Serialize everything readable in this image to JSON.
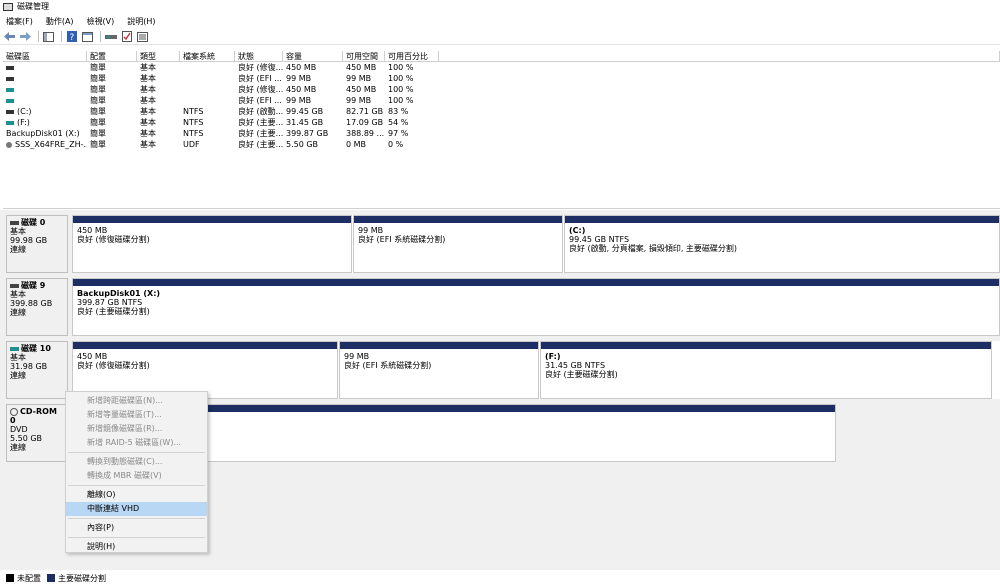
{
  "window": {
    "title": "磁碟管理"
  },
  "menu": [
    "檔案(F)",
    "動作(A)",
    "檢視(V)",
    "說明(H)"
  ],
  "table": {
    "headers": [
      "磁碟區",
      "配置",
      "類型",
      "檔案系統",
      "狀態",
      "容量",
      "可用空間",
      "可用百分比"
    ],
    "rows": [
      {
        "name": "",
        "layout": "簡單",
        "type": "基本",
        "fs": "",
        "status": "良好 (修復...",
        "capacity": "450 MB",
        "free": "450 MB",
        "pct": "100 %",
        "icon": "drive-icon"
      },
      {
        "name": "",
        "layout": "簡單",
        "type": "基本",
        "fs": "",
        "status": "良好 (EFI ...",
        "capacity": "99 MB",
        "free": "99 MB",
        "pct": "100 %",
        "icon": "drive-icon"
      },
      {
        "name": "",
        "layout": "簡單",
        "type": "基本",
        "fs": "",
        "status": "良好 (修復...",
        "capacity": "450 MB",
        "free": "450 MB",
        "pct": "100 %",
        "icon": "drive-icon-teal"
      },
      {
        "name": "",
        "layout": "簡單",
        "type": "基本",
        "fs": "",
        "status": "良好 (EFI ...",
        "capacity": "99 MB",
        "free": "99 MB",
        "pct": "100 %",
        "icon": "drive-icon-teal"
      },
      {
        "name": "(C:)",
        "layout": "簡單",
        "type": "基本",
        "fs": "NTFS",
        "status": "良好 (啟動...",
        "capacity": "99.45 GB",
        "free": "82.71 GB",
        "pct": "83 %",
        "icon": "drive-icon"
      },
      {
        "name": "(F:)",
        "layout": "簡單",
        "type": "基本",
        "fs": "NTFS",
        "status": "良好 (主要...",
        "capacity": "31.45 GB",
        "free": "17.09 GB",
        "pct": "54 %",
        "icon": "drive-icon-teal"
      },
      {
        "name": "BackupDisk01 (X:)",
        "layout": "簡單",
        "type": "基本",
        "fs": "NTFS",
        "status": "良好 (主要...",
        "capacity": "399.87 GB",
        "free": "388.89 ...",
        "pct": "97 %",
        "icon": "none"
      },
      {
        "name": "SSS_X64FRE_ZH-...",
        "layout": "簡單",
        "type": "基本",
        "fs": "UDF",
        "status": "良好 (主要...",
        "capacity": "5.50 GB",
        "free": "0 MB",
        "pct": "0 %",
        "icon": "cd-icon"
      }
    ]
  },
  "disks": [
    {
      "name": "磁碟 0",
      "type": "基本",
      "size": "99.98 GB",
      "state": "連線",
      "partitions": [
        {
          "name": "",
          "size": "450 MB",
          "status": "良好 (修復磁碟分割)"
        },
        {
          "name": "",
          "size": "99 MB",
          "status": "良好 (EFI 系統磁碟分割)"
        },
        {
          "name": "(C:)",
          "size": "99.45 GB NTFS",
          "status": "良好 (啟動, 分頁檔案, 損毀傾印, 主要磁碟分割)"
        }
      ]
    },
    {
      "name": "磁碟 9",
      "type": "基本",
      "size": "399.88 GB",
      "state": "連線",
      "partitions": [
        {
          "name": "BackupDisk01 (X:)",
          "size": "399.87 GB NTFS",
          "status": "良好 (主要磁碟分割)"
        }
      ]
    },
    {
      "name": "磁碟 10",
      "type": "基本",
      "size": "31.98 GB",
      "state": "連線",
      "partitions": [
        {
          "name": "",
          "size": "450 MB",
          "status": "良好 (修復磁碟分割)"
        },
        {
          "name": "",
          "size": "99 MB",
          "status": "良好 (EFI 系統磁碟分割)"
        },
        {
          "name": "(F:)",
          "size": "31.45 GB NTFS",
          "status": "良好 (主要磁碟分割)"
        }
      ]
    },
    {
      "name": "CD-ROM 0",
      "type": "DVD",
      "size": "5.50 GB",
      "state": "連線",
      "partitions": []
    }
  ],
  "context_menu": [
    {
      "label": "新增跨距磁碟區(N)...",
      "disabled": true
    },
    {
      "label": "新增等量磁碟區(T)...",
      "disabled": true
    },
    {
      "label": "新增鏡像磁碟區(R)...",
      "disabled": true
    },
    {
      "label": "新增 RAID-5 磁碟區(W)...",
      "disabled": true
    },
    {
      "sep": true
    },
    {
      "label": "轉換到動態磁碟(C)...",
      "disabled": true
    },
    {
      "label": "轉換成 MBR 磁碟(V)",
      "disabled": true
    },
    {
      "sep": true
    },
    {
      "label": "離線(O)",
      "disabled": false
    },
    {
      "label": "中斷連結 VHD",
      "disabled": false,
      "highlighted": true
    },
    {
      "sep": true
    },
    {
      "label": "內容(P)",
      "disabled": false
    },
    {
      "sep": true
    },
    {
      "label": "說明(H)",
      "disabled": false
    }
  ],
  "legend": [
    {
      "label": "未配置",
      "color": "#000000"
    },
    {
      "label": "主要磁碟分割",
      "color": "#1c2e63"
    }
  ],
  "colors": {
    "primary_partition": "#1c2e63",
    "unallocated": "#000000",
    "highlight": "#b8d7f5"
  }
}
